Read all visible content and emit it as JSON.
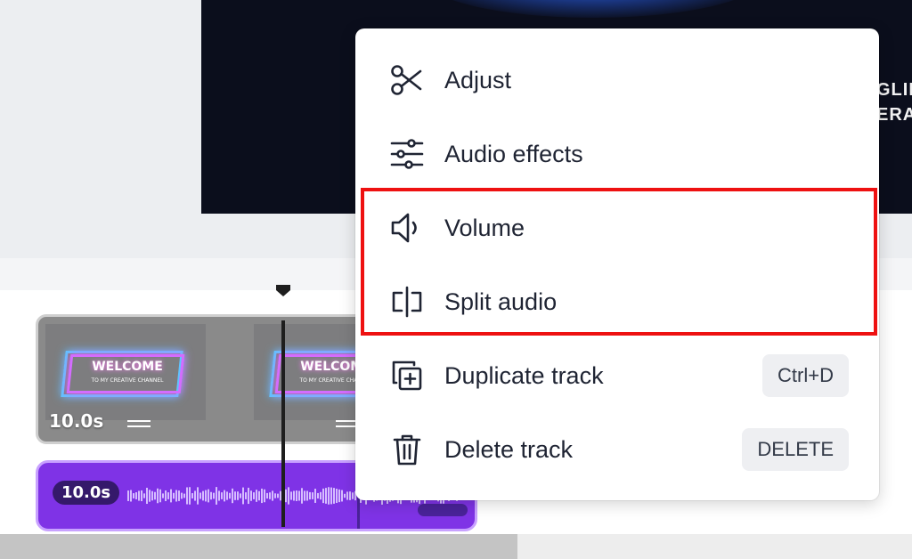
{
  "preview": {
    "title_line1": "GLIF",
    "title_line2": "ERAP"
  },
  "timeline": {
    "video_clip": {
      "duration": "10.0s",
      "thumbnail_title": "WELCOME",
      "thumbnail_subtitle": "TO MY CREATIVE CHANNEL"
    },
    "audio_clip": {
      "duration": "10.0s"
    }
  },
  "context_menu": {
    "items": [
      {
        "label": "Adjust",
        "icon": "scissors-icon",
        "shortcut": ""
      },
      {
        "label": "Audio effects",
        "icon": "sliders-icon",
        "shortcut": ""
      },
      {
        "label": "Volume",
        "icon": "speaker-icon",
        "shortcut": ""
      },
      {
        "label": "Split audio",
        "icon": "split-icon",
        "shortcut": ""
      },
      {
        "label": "Duplicate track",
        "icon": "duplicate-icon",
        "shortcut": "Ctrl+D"
      },
      {
        "label": "Delete track",
        "icon": "trash-icon",
        "shortcut": "DELETE"
      }
    ]
  },
  "colors": {
    "highlight": "#ee1111",
    "audio_clip": "#7f33e6",
    "menu_text": "#1f2433"
  }
}
